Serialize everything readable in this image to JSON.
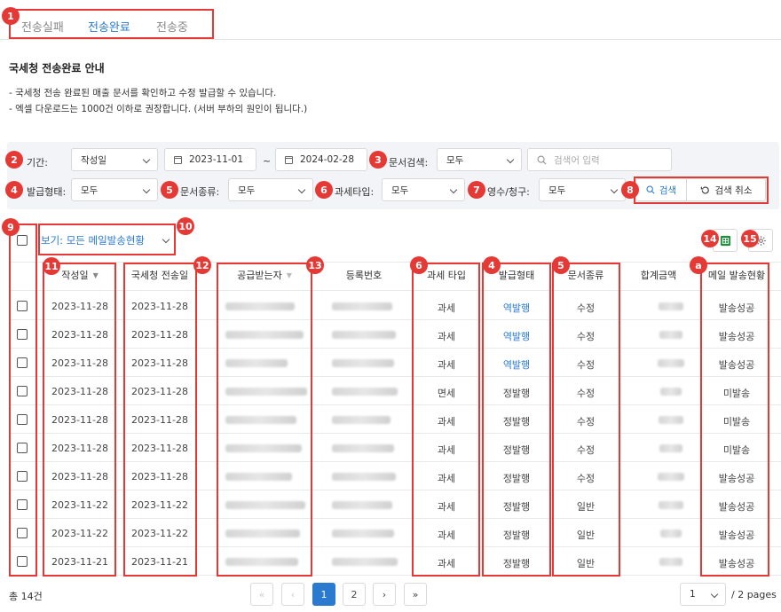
{
  "tabs": [
    {
      "label": "전송실패"
    },
    {
      "label": "전송완료"
    },
    {
      "label": "전송중"
    }
  ],
  "title": "국세청 전송완료 안내",
  "descriptions": [
    "- 국세청 전송 완료된 매출 문서를 확인하고 수정 발급할 수 있습니다.",
    "- 엑셀 다운로드는 1000건 이하로 권장합니다. (서버 부하의 원인이 됩니다.)"
  ],
  "filters": {
    "period_label": "기간:",
    "period_type": "작성일",
    "date_from": "2023-11-01",
    "date_sep": "~",
    "date_to": "2024-02-28",
    "doc_search_label": "문서검색:",
    "doc_search_value": "모두",
    "search_placeholder": "검색어 입력",
    "issue_type_label": "발급형태:",
    "issue_type_value": "모두",
    "doc_kind_label": "문서종류:",
    "doc_kind_value": "모두",
    "tax_type_label": "과세타입:",
    "tax_type_value": "모두",
    "receipt_label": "영수/청구:",
    "receipt_value": "모두",
    "search_button": "검색",
    "reset_button": "검색 취소"
  },
  "view_select": "보기: 모든 메일발송현황",
  "icons": {
    "excel": "excel-icon",
    "settings": "gear-icon"
  },
  "colors": {
    "accent": "#2a7ad0",
    "annotation": "#e53935",
    "excel": "#1e8e3e"
  },
  "badges": [
    "1",
    "2",
    "3",
    "4",
    "5",
    "6",
    "7",
    "8",
    "9",
    "10",
    "11",
    "12",
    "13",
    "14",
    "15",
    "4",
    "5",
    "6",
    "a"
  ],
  "columns": [
    "작성일",
    "국세청 전송일",
    "공급받는자",
    "등록번호",
    "과세 타입",
    "발급형태",
    "문서종류",
    "합계금액",
    "메일 발송현황"
  ],
  "sort_arrow": "▼",
  "rows": [
    {
      "date": "2023-11-28",
      "sent": "2023-11-28",
      "tax": "과세",
      "issue": "역발행",
      "kind": "수정",
      "mail": "발송성공"
    },
    {
      "date": "2023-11-28",
      "sent": "2023-11-28",
      "tax": "과세",
      "issue": "역발행",
      "kind": "수정",
      "mail": "발송성공"
    },
    {
      "date": "2023-11-28",
      "sent": "2023-11-28",
      "tax": "과세",
      "issue": "역발행",
      "kind": "수정",
      "mail": "발송성공"
    },
    {
      "date": "2023-11-28",
      "sent": "2023-11-28",
      "tax": "면세",
      "issue": "정발행",
      "kind": "수정",
      "mail": "미발송"
    },
    {
      "date": "2023-11-28",
      "sent": "2023-11-28",
      "tax": "과세",
      "issue": "정발행",
      "kind": "수정",
      "mail": "미발송"
    },
    {
      "date": "2023-11-28",
      "sent": "2023-11-28",
      "tax": "과세",
      "issue": "정발행",
      "kind": "수정",
      "mail": "미발송"
    },
    {
      "date": "2023-11-28",
      "sent": "2023-11-28",
      "tax": "과세",
      "issue": "정발행",
      "kind": "수정",
      "mail": "발송성공"
    },
    {
      "date": "2023-11-22",
      "sent": "2023-11-22",
      "tax": "과세",
      "issue": "정발행",
      "kind": "일반",
      "mail": "발송성공"
    },
    {
      "date": "2023-11-22",
      "sent": "2023-11-22",
      "tax": "과세",
      "issue": "정발행",
      "kind": "일반",
      "mail": "발송성공"
    },
    {
      "date": "2023-11-21",
      "sent": "2023-11-21",
      "tax": "과세",
      "issue": "정발행",
      "kind": "일반",
      "mail": "발송성공"
    }
  ],
  "footer": {
    "total": "총 14건",
    "page1": "1",
    "page2": "2",
    "page_select": "1",
    "page_total": "/ 2 pages",
    "first_glyph": "«",
    "prev_glyph": "‹",
    "next_glyph": "›",
    "last_glyph": "»"
  }
}
